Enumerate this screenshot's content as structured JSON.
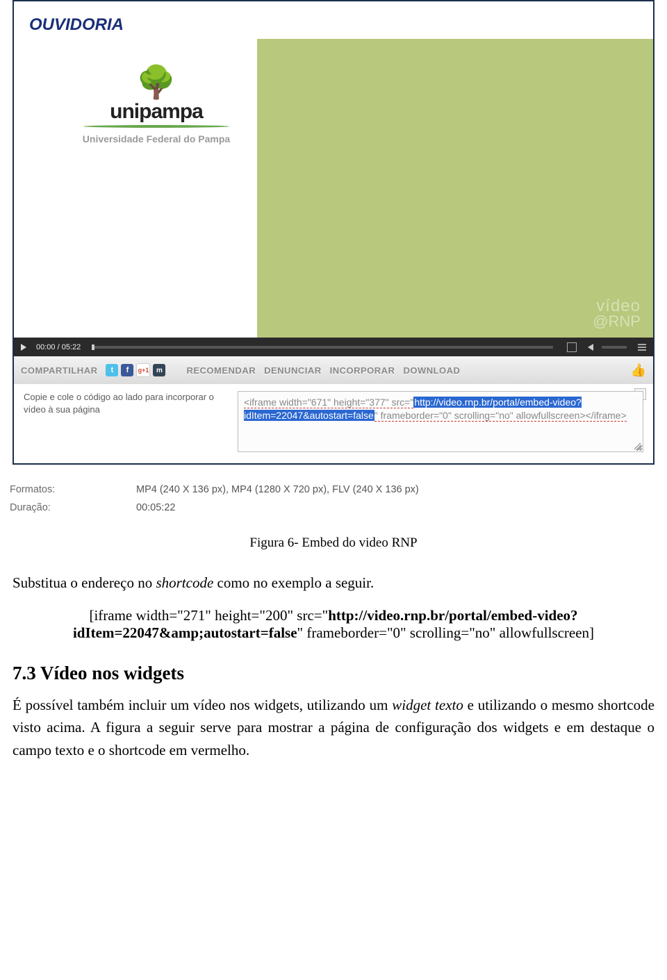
{
  "screenshot": {
    "ouvidoria_heading": "OUVIDORIA",
    "logo": {
      "name": "unipampa",
      "sub": "Universidade Federal do Pampa"
    },
    "watermark": {
      "line1": "vídeo",
      "line2": "@RNP"
    },
    "player": {
      "time": "00:00 / 05:22"
    },
    "share_bar": {
      "share_label": "COMPARTILHAR",
      "icons": {
        "twitter": "t",
        "facebook": "f",
        "google": "g+1",
        "myspace": "m"
      },
      "actions": {
        "recommend": "RECOMENDAR",
        "report": "DENUNCIAR",
        "embed": "INCORPORAR",
        "download": "DOWNLOAD"
      }
    },
    "embed": {
      "instructions": "Copie e cole o código ao lado para incorporar o vídeo à sua página",
      "code_pre": "<iframe width=\"671\" height=\"377\" src=\"",
      "code_hl": "http://video.rnp.br/portal/embed-video?idItem=22047&autostart=false",
      "code_post": "\" frameborder=\"0\" scrolling=\"no\" allowfullscreen></iframe>"
    },
    "meta": {
      "format_label": "Formatos:",
      "format_value": "MP4 (240 X 136 px), MP4 (1280 X 720 px), FLV (240 X 136 px)",
      "duration_label": "Duração:",
      "duration_value": "00:05:22"
    }
  },
  "caption": "Figura 6- Embed do video RNP",
  "body": {
    "para_substitute_1": "Substitua o endereço no ",
    "shortcode_word": "shortcode",
    "para_substitute_2": " como no exemplo a seguir.",
    "code_line1_a": "[iframe width=\"271\" height=\"200\" src=\"",
    "code_line1_b": "http://video.rnp.br/portal/embed-video?",
    "code_line2_a": "idItem=22047&amp;autostart=false",
    "code_line2_b": "\" frameborder=\"0\" scrolling=\"no\" allowfullscreen]",
    "section_heading": "7.3 Vídeo nos widgets",
    "section_para_1": "É possível também incluir um vídeo nos widgets, utilizando um ",
    "widget_texto": "widget texto",
    "section_para_2": " e utilizando o mesmo shortcode visto acima. A figura a seguir serve para mostrar a página de configuração dos widgets e em destaque o campo texto e o shortcode em vermelho."
  }
}
